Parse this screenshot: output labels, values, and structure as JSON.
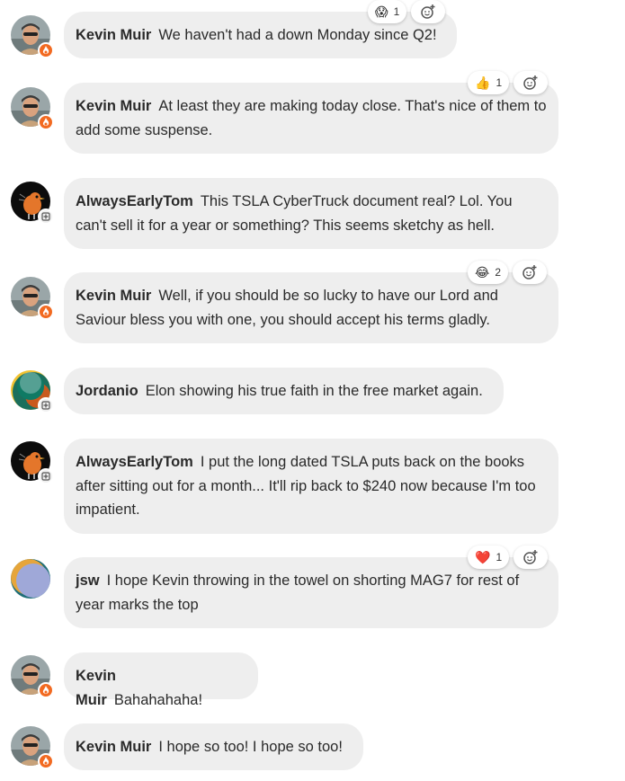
{
  "messages": [
    {
      "author": "Kevin Muir",
      "text": "We haven't had a down Monday since Q2!",
      "avatar": "kevin",
      "reactions": [
        {
          "emoji": "😱",
          "count": "1"
        }
      ]
    },
    {
      "author": "Kevin Muir",
      "text": "At least they are making today close. That's nice of them to add some suspense.",
      "avatar": "kevin",
      "reactions": [
        {
          "emoji": "👍",
          "count": "1"
        }
      ]
    },
    {
      "author": "AlwaysEarlyTom",
      "text": "This TSLA CyberTruck document real? Lol. You can't sell it for a year or something? This seems sketchy as hell.",
      "avatar": "tom",
      "reactions": []
    },
    {
      "author": "Kevin Muir",
      "text": "Well, if you should be so lucky to have our Lord and Saviour bless you with one, you should accept his terms gladly.",
      "avatar": "kevin",
      "reactions": [
        {
          "emoji": "😂",
          "count": "2"
        }
      ]
    },
    {
      "author": "Jordanio",
      "text": "Elon showing his true faith in the free market again.",
      "avatar": "jordanio",
      "reactions": []
    },
    {
      "author": "AlwaysEarlyTom",
      "text": "I put the long dated TSLA puts back on the books after sitting out for a month... It'll rip back to $240 now because I'm too impatient.",
      "avatar": "tom",
      "reactions": []
    },
    {
      "author": "jsw",
      "text": "I hope Kevin throwing in the towel on shorting MAG7 for rest of year marks the top",
      "avatar": "jsw",
      "reactions": [
        {
          "emoji": "❤️",
          "count": "1"
        }
      ]
    },
    {
      "author": "Kevin Muir",
      "text": "Bahahahaha!",
      "avatar": "kevin",
      "reactions": []
    },
    {
      "author": "Kevin Muir",
      "text": "I hope so too! I hope so too!",
      "avatar": "kevin",
      "reactions": []
    }
  ]
}
